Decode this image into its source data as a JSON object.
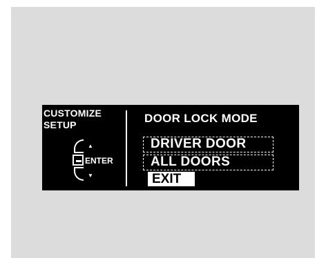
{
  "display": {
    "left_panel": {
      "title": "CUSTOMIZE\nSETUP",
      "enter_label": "ENTER",
      "up_arrow": "▲",
      "down_arrow": "▼"
    },
    "menu": {
      "title": "DOOR LOCK MODE",
      "items": [
        {
          "label": "DRIVER DOOR"
        },
        {
          "label": "ALL DOORS"
        }
      ],
      "exit_label": "EXIT"
    }
  },
  "colors": {
    "background": "#dcdcdc",
    "display": "#000000",
    "text": "#ffffff"
  },
  "icons": [
    "selector-dial-icon",
    "enter-button-icon",
    "up-arrow-icon",
    "down-arrow-icon"
  ]
}
